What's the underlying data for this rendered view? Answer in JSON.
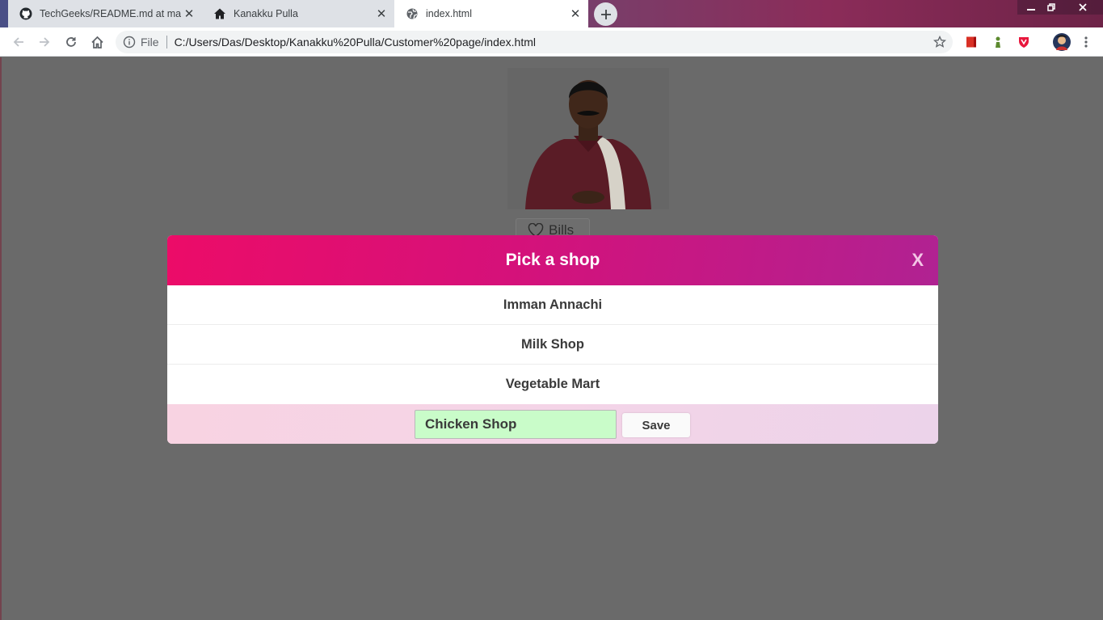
{
  "browser": {
    "tabs": [
      {
        "title": "TechGeeks/README.md at maste",
        "icon": "github-icon"
      },
      {
        "title": "Kanakku Pulla",
        "icon": "home-icon"
      },
      {
        "title": "index.html",
        "icon": "globe-icon"
      }
    ],
    "address": {
      "scheme_label": "File",
      "url": "C:/Users/Das/Desktop/Kanakku%20Pulla/Customer%20page/index.html"
    }
  },
  "page": {
    "bills_button_label": "Bills"
  },
  "modal": {
    "title": "Pick a shop",
    "close_label": "X",
    "shops": [
      "Imman Annachi",
      "Milk Shop",
      "Vegetable Mart"
    ],
    "new_shop_value": "Chicken Shop",
    "save_label": "Save"
  },
  "colors": {
    "modal_header_start": "#ec0c68",
    "modal_header_end": "#b02292",
    "input_bg": "#c9fcc9",
    "overlay": "#6a6a6a"
  }
}
